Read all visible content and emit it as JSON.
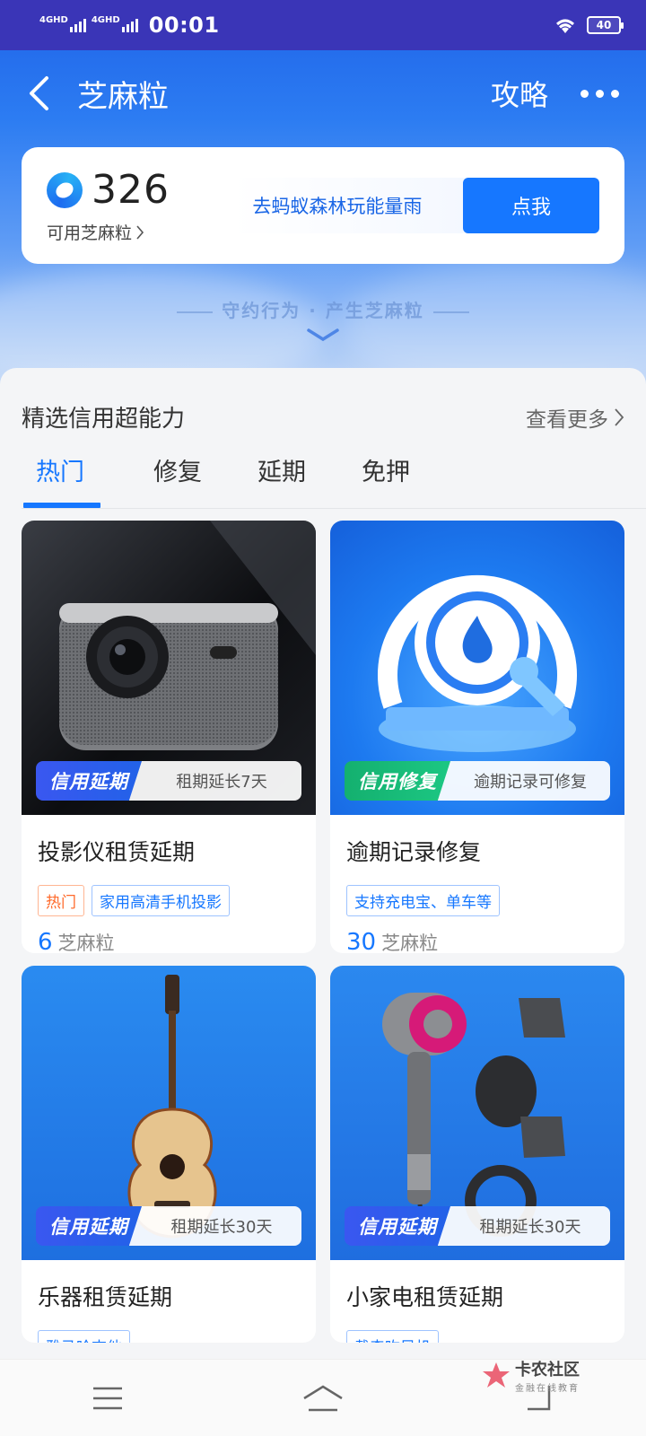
{
  "status_bar": {
    "network_1": "4GHD",
    "network_2": "4GHD",
    "time": "00:01",
    "battery": "40"
  },
  "header": {
    "title": "芝麻粒",
    "guide_label": "攻略"
  },
  "balance": {
    "value": "326",
    "label": "可用芝麻粒",
    "promo_text": "去蚂蚁森林玩能量雨",
    "promo_button": "点我"
  },
  "slogan": "守约行为 · 产生芝麻粒",
  "section": {
    "title": "精选信用超能力",
    "see_more": "查看更多"
  },
  "tabs": [
    {
      "label": "热门",
      "active": true
    },
    {
      "label": "修复",
      "active": false
    },
    {
      "label": "延期",
      "active": false
    },
    {
      "label": "免押",
      "active": false
    }
  ],
  "cards": [
    {
      "badge_tag": "信用延期",
      "badge_text": "租期延长7天",
      "title": "投影仪租赁延期",
      "tags": [
        "热门",
        "家用高清手机投影"
      ],
      "price": "6",
      "price_unit": "芝麻粒",
      "image": "projector"
    },
    {
      "badge_tag": "信用修复",
      "badge_text": "逾期记录可修复",
      "title": "逾期记录修复",
      "tags": [
        "支持充电宝、单车等"
      ],
      "price": "30",
      "price_unit": "芝麻粒",
      "image": "repair-gauge"
    },
    {
      "badge_tag": "信用延期",
      "badge_text": "租期延长30天",
      "title": "乐器租赁延期",
      "tags": [
        "雅马哈吉他"
      ],
      "image": "guitar"
    },
    {
      "badge_tag": "信用延期",
      "badge_text": "租期延长30天",
      "title": "小家电租赁延期",
      "tags": [
        "戴森吹风机"
      ],
      "image": "hair-dryer"
    }
  ],
  "watermark": {
    "main": "卡农社区",
    "sub": "金融在线教育"
  },
  "colors": {
    "accent": "#1677ff",
    "hot": "#ff6a2b",
    "status_bar": "#3a35b7"
  }
}
